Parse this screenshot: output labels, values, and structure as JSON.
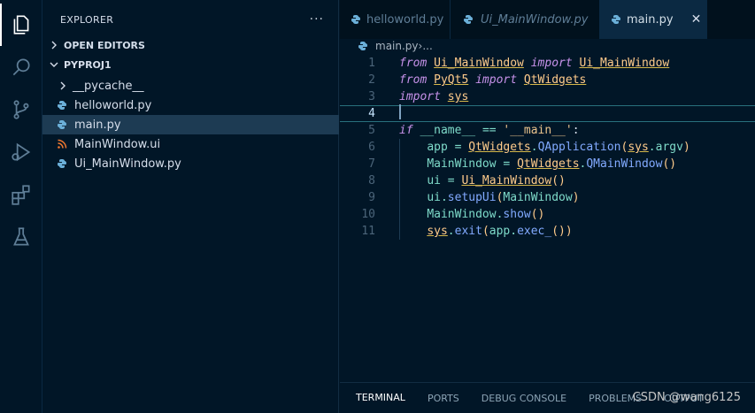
{
  "sidebar": {
    "title": "EXPLORER",
    "more": "···",
    "open_editors": "OPEN EDITORS",
    "project": "PYPROJ1",
    "items": [
      {
        "label": "__pycache__",
        "kind": "folder"
      },
      {
        "label": "helloworld.py",
        "kind": "python"
      },
      {
        "label": "main.py",
        "kind": "python",
        "selected": true
      },
      {
        "label": "MainWindow.ui",
        "kind": "rss"
      },
      {
        "label": "Ui_MainWindow.py",
        "kind": "python"
      }
    ]
  },
  "tabs": [
    {
      "label": "helloworld.py"
    },
    {
      "label": "Ui_MainWindow.py"
    },
    {
      "label": "main.py",
      "active": true
    }
  ],
  "tab_close": "✕",
  "breadcrumb": {
    "file": "main.py",
    "sep": " › ",
    "rest": "..."
  },
  "editor": {
    "line_numbers": [
      "1",
      "2",
      "3",
      "4",
      "5",
      "6",
      "7",
      "8",
      "9",
      "10",
      "11"
    ],
    "lines": [
      {
        "indent": "",
        "tokens": [
          [
            "kw",
            "from"
          ],
          [
            "plain",
            " "
          ],
          [
            "cls ul",
            "Ui_MainWindow"
          ],
          [
            "plain",
            " "
          ],
          [
            "kw",
            "import"
          ],
          [
            "plain",
            " "
          ],
          [
            "cls ul",
            "Ui_MainWindow"
          ]
        ]
      },
      {
        "indent": "",
        "tokens": [
          [
            "kw",
            "from"
          ],
          [
            "plain",
            " "
          ],
          [
            "cls ul",
            "PyQt5"
          ],
          [
            "plain",
            " "
          ],
          [
            "kw",
            "import"
          ],
          [
            "plain",
            " "
          ],
          [
            "cls ul",
            "QtWidgets"
          ]
        ]
      },
      {
        "indent": "",
        "tokens": [
          [
            "kw",
            "import"
          ],
          [
            "plain",
            " "
          ],
          [
            "cls ul",
            "sys"
          ]
        ]
      },
      {
        "indent": "",
        "tokens": []
      },
      {
        "indent": "",
        "tokens": [
          [
            "kw",
            "if"
          ],
          [
            "plain",
            " "
          ],
          [
            "var",
            "__name__"
          ],
          [
            "plain",
            " "
          ],
          [
            "pn",
            "=="
          ],
          [
            "plain",
            " "
          ],
          [
            "str",
            "'__main__'"
          ],
          [
            "plain",
            ":"
          ]
        ]
      },
      {
        "indent": "    ",
        "tokens": [
          [
            "var",
            "app"
          ],
          [
            "plain",
            " "
          ],
          [
            "pn",
            "="
          ],
          [
            "plain",
            " "
          ],
          [
            "cls ul",
            "QtWidgets"
          ],
          [
            "pn",
            "."
          ],
          [
            "fn",
            "QApplication"
          ],
          [
            "cls",
            "("
          ],
          [
            "cls ul",
            "sys"
          ],
          [
            "pn",
            "."
          ],
          [
            "var",
            "argv"
          ],
          [
            "cls",
            ")"
          ]
        ]
      },
      {
        "indent": "    ",
        "tokens": [
          [
            "var",
            "MainWindow"
          ],
          [
            "plain",
            " "
          ],
          [
            "pn",
            "="
          ],
          [
            "plain",
            " "
          ],
          [
            "cls ul",
            "QtWidgets"
          ],
          [
            "pn",
            "."
          ],
          [
            "fn",
            "QMainWindow"
          ],
          [
            "cls",
            "()"
          ]
        ]
      },
      {
        "indent": "    ",
        "tokens": [
          [
            "var",
            "ui"
          ],
          [
            "plain",
            " "
          ],
          [
            "pn",
            "="
          ],
          [
            "plain",
            " "
          ],
          [
            "cls ul",
            "Ui_MainWindow"
          ],
          [
            "cls",
            "()"
          ]
        ]
      },
      {
        "indent": "    ",
        "tokens": [
          [
            "var",
            "ui"
          ],
          [
            "pn",
            "."
          ],
          [
            "fn",
            "setupUi"
          ],
          [
            "cls",
            "("
          ],
          [
            "var",
            "MainWindow"
          ],
          [
            "cls",
            ")"
          ]
        ]
      },
      {
        "indent": "    ",
        "tokens": [
          [
            "var",
            "MainWindow"
          ],
          [
            "pn",
            "."
          ],
          [
            "fn",
            "show"
          ],
          [
            "cls",
            "()"
          ]
        ]
      },
      {
        "indent": "    ",
        "tokens": [
          [
            "cls ul",
            "sys"
          ],
          [
            "pn",
            "."
          ],
          [
            "fn",
            "exit"
          ],
          [
            "cls",
            "("
          ],
          [
            "var",
            "app"
          ],
          [
            "pn",
            "."
          ],
          [
            "fn",
            "exec_"
          ],
          [
            "cls",
            "())"
          ]
        ]
      }
    ],
    "current_line": 4
  },
  "panel": {
    "tabs": [
      "TERMINAL",
      "PORTS",
      "DEBUG CONSOLE",
      "PROBLEMS",
      "OUTPUT"
    ],
    "active": "TERMINAL"
  },
  "watermark": "CSDN @wang6125",
  "colors": {
    "accent": "#1d3b53",
    "background": "#011627"
  }
}
